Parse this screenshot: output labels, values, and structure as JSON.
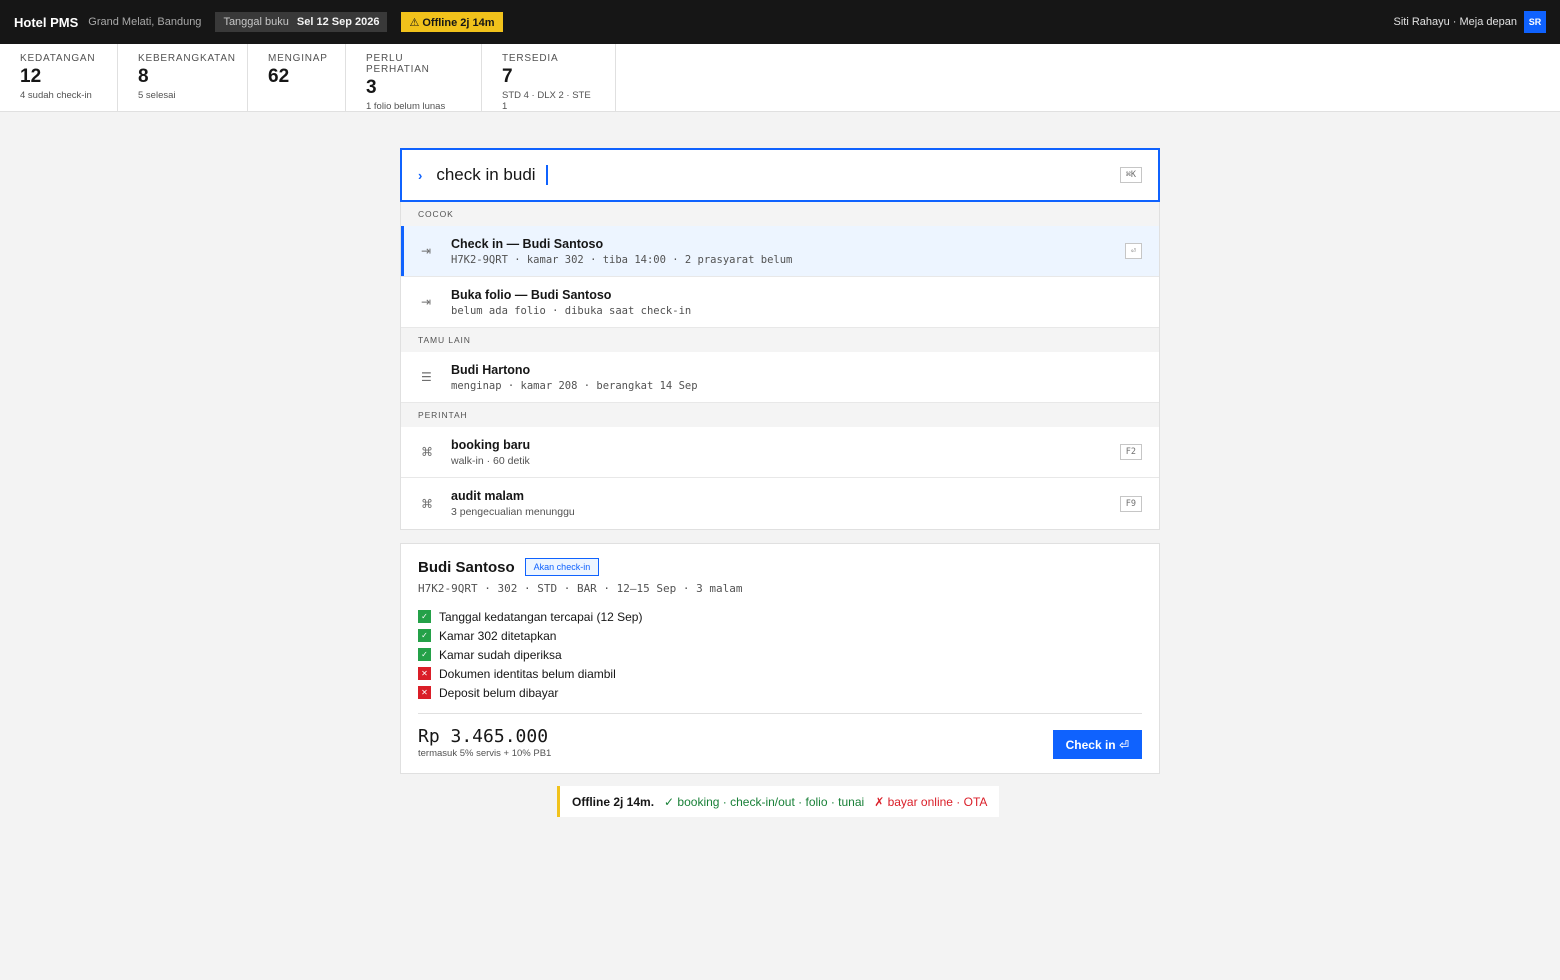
{
  "topbar": {
    "app_name": "Hotel PMS",
    "property": "Grand Melati, Bandung",
    "business_date_label": "Tanggal buku",
    "business_date": "Sel 12 Sep 2026",
    "offline_badge": "⚠ Offline 2j 14m",
    "user": "Siti Rahayu · Meja depan",
    "avatar_initials": "SR"
  },
  "kpis": [
    {
      "label": "Kedatangan",
      "value": "12",
      "sub": "4 sudah check-in"
    },
    {
      "label": "Keberangkatan",
      "value": "8",
      "sub": "5 selesai"
    },
    {
      "label": "Menginap",
      "value": "62",
      "sub": ""
    },
    {
      "label": "Perlu perhatian",
      "value": "3",
      "sub": "1 folio belum lunas"
    },
    {
      "label": "Tersedia",
      "value": "7",
      "sub": "STD 4 · DLX 2 · STE 1"
    }
  ],
  "palette": {
    "prompt_icon": "›",
    "query": "check in budi",
    "shortcut": "⌘K",
    "groups": {
      "match": "Cocok",
      "other_guests": "Tamu lain",
      "commands": "Perintah"
    },
    "results": {
      "checkin": {
        "icon": "⇥",
        "title": "Check in — Budi Santoso",
        "sub": "H7K2-9QRT · kamar 302 · tiba 14:00 · 2 prasyarat belum",
        "key": "⏎"
      },
      "folio": {
        "icon": "⇥",
        "title": "Buka folio — Budi Santoso",
        "sub": "belum ada folio · dibuka saat check-in"
      },
      "hartono": {
        "icon": "☰",
        "title": "Budi Hartono",
        "sub": "menginap · kamar 208 · berangkat 14 Sep"
      },
      "new_booking": {
        "icon": "⌘",
        "title": "booking baru",
        "sub": "walk-in · 60 detik",
        "key": "F2"
      },
      "night_audit": {
        "icon": "⌘",
        "title": "audit malam",
        "sub": "3 pengecualian menunggu",
        "key": "F9"
      }
    }
  },
  "detail": {
    "guest_name": "Budi Santoso",
    "status": "Akan check-in",
    "meta": "H7K2-9QRT · 302 · STD · BAR · 12–15 Sep · 3 malam",
    "checks": [
      {
        "ok": true,
        "text": "Tanggal kedatangan tercapai (12 Sep)"
      },
      {
        "ok": true,
        "text": "Kamar 302 ditetapkan"
      },
      {
        "ok": true,
        "text": "Kamar sudah diperiksa"
      },
      {
        "ok": false,
        "text": "Dokumen identitas belum diambil"
      },
      {
        "ok": false,
        "text": "Deposit belum dibayar"
      }
    ],
    "check_marks": {
      "ok": "✓",
      "no": "✕"
    },
    "amount": "Rp 3.465.000",
    "amount_note": "termasuk 5% servis + 10% PB1",
    "action_label": "Check in ⏎"
  },
  "notice": {
    "title": "Offline 2j 14m.",
    "available": "✓ booking · check-in/out · folio · tunai",
    "unavailable": "✗ bayar online · OTA"
  },
  "colors": {
    "accent": "#0f62fe",
    "warning": "#f1c21b",
    "success": "#24a148",
    "danger": "#da1e28"
  }
}
